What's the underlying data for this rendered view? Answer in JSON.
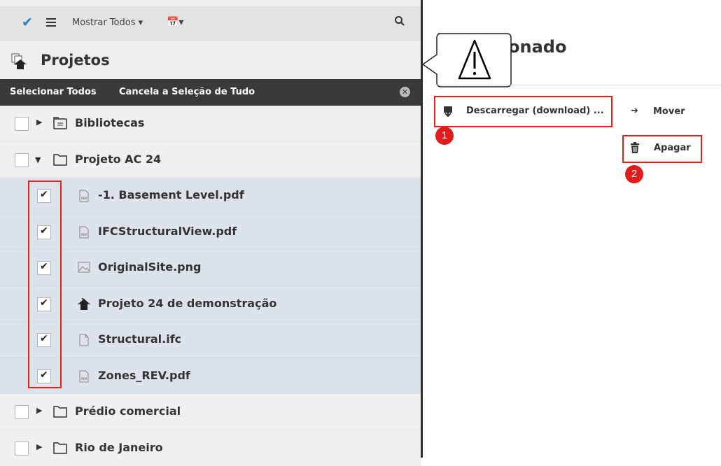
{
  "toolbar": {
    "check_icon": "checkmark-icon",
    "list_icon": "list-icon",
    "show_label": "Mostrar Todos",
    "calendar_icon": "calendar-icon",
    "search_icon": "search-icon"
  },
  "panel": {
    "title": "Projetos",
    "select_all": "Selecionar Todos",
    "deselect_all": "Cancela a Seleção de Tudo"
  },
  "tree": {
    "bibliotecas": "Bibliotecas",
    "projeto_ac24": "Projeto AC 24",
    "files": [
      "-1. Basement Level.pdf",
      "IFCStructuralView.pdf",
      "OriginalSite.png",
      "Projeto 24 de demonstração",
      "Structural.ifc",
      "Zones_REV.pdf"
    ],
    "predio": "Prédio comercial",
    "rio": "Rio de Janeiro"
  },
  "right": {
    "title_partial": "onado",
    "download": "Descarregar (download) ...",
    "move": "Mover",
    "delete": "Apagar",
    "badge1": "1",
    "badge2": "2"
  },
  "colors": {
    "accent": "#2c7bc5",
    "annotation_red": "#e0231f",
    "selected_row": "#dde3ea",
    "dark_bar": "#3a3a3a"
  }
}
